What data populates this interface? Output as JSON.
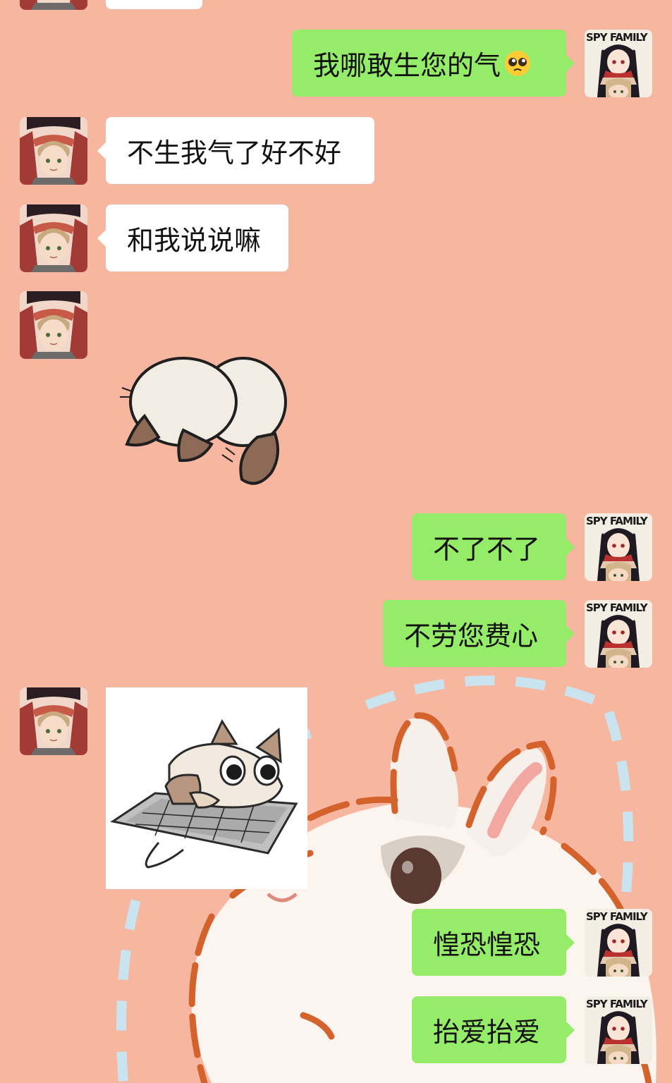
{
  "colors": {
    "background": "#f7b6a0",
    "bubble_incoming": "#ffffff",
    "bubble_outgoing": "#95ec69",
    "dash_blue": "#c9e4ee",
    "rabbit_outline": "#d4622d"
  },
  "self_avatar": {
    "badge_text": "SPY FAMILY"
  },
  "messages": [
    {
      "side": "in",
      "type": "text",
      "text": ""
    },
    {
      "side": "out",
      "type": "text",
      "text": "我哪敢生您的气",
      "emoji": "pleading-face-emoji"
    },
    {
      "side": "in",
      "type": "text",
      "text": "不生我气了好不好"
    },
    {
      "side": "in",
      "type": "text",
      "text": "和我说说嘛"
    },
    {
      "side": "in",
      "type": "sticker",
      "sticker": "siamese-cat-curled-sticker"
    },
    {
      "side": "out",
      "type": "text",
      "text": "不了不了"
    },
    {
      "side": "out",
      "type": "text",
      "text": "不劳您费心"
    },
    {
      "side": "in",
      "type": "sticker",
      "sticker": "siamese-cat-keyboard-sticker"
    },
    {
      "side": "out",
      "type": "text",
      "text": "惶恐惶恐"
    },
    {
      "side": "out",
      "type": "text",
      "text": "抬爱抬爱"
    }
  ]
}
